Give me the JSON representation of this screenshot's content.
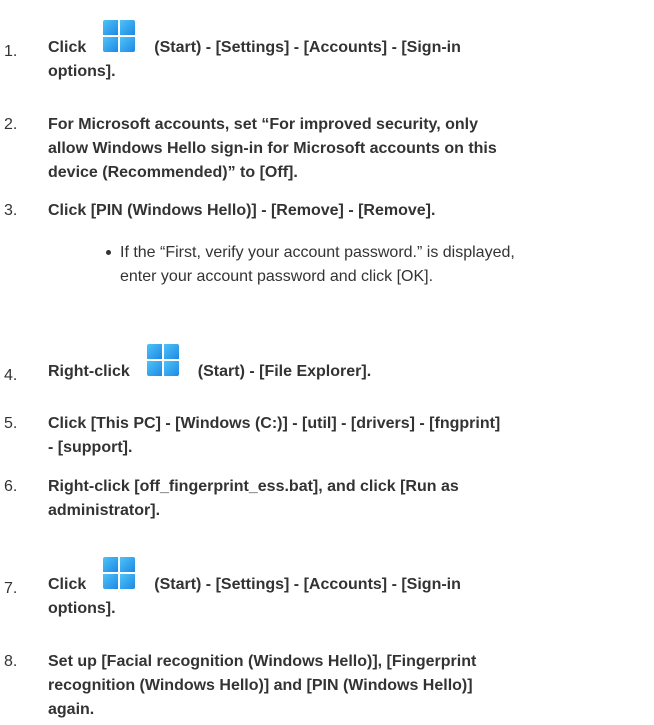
{
  "steps": [
    {
      "number": "1.",
      "prefix": "Click",
      "icon": "windows-start-icon",
      "suffix": "(Start) - [Settings] - [Accounts] - [Sign-in",
      "line2": "options]."
    },
    {
      "number": "2.",
      "line1": "For Microsoft accounts, set “For improved security, only",
      "line2": "allow Windows Hello sign-in for Microsoft accounts on this",
      "line3": "device (Recommended)” to [Off]."
    },
    {
      "number": "3.",
      "line1": "Click [PIN (Windows Hello)] - [Remove] - [Remove].",
      "bullet_line1": "If the “First, verify your account password.” is displayed,",
      "bullet_line2": "enter your account password and click [OK]."
    },
    {
      "number": "4.",
      "prefix": "Right-click",
      "icon": "windows-start-icon",
      "suffix": "(Start) - [File Explorer]."
    },
    {
      "number": "5.",
      "line1": "Click [This PC] - [Windows (C:)] - [util] - [drivers] - [fngprint]",
      "line2": "- [support]."
    },
    {
      "number": "6.",
      "line1": "Right-click [off_fingerprint_ess.bat], and click [Run as",
      "line2": "administrator]."
    },
    {
      "number": "7.",
      "prefix": "Click",
      "icon": "windows-start-icon",
      "suffix": "(Start) - [Settings] - [Accounts] - [Sign-in",
      "line2": "options]."
    },
    {
      "number": "8.",
      "line1": "Set up [Facial recognition (Windows Hello)], [Fingerprint",
      "line2": "recognition (Windows Hello)] and [PIN (Windows Hello)]",
      "line3": "again."
    }
  ],
  "colors": {
    "text": "#333333",
    "icon_light": "#4fc3f7",
    "icon_dark": "#1e88e5"
  }
}
